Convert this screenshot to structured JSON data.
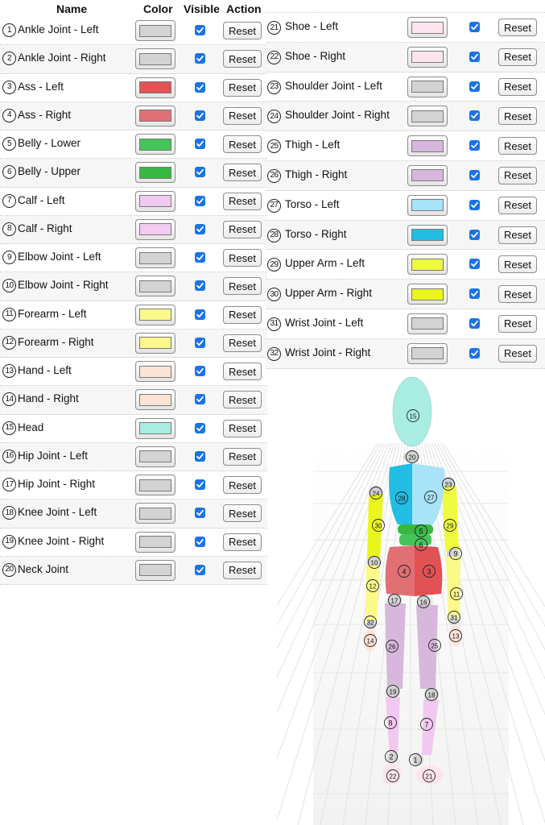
{
  "table": {
    "headers": {
      "name": "Name",
      "color": "Color",
      "visible": "Visible",
      "action": "Action"
    },
    "parts": [
      {
        "num": "1",
        "name": "Ankle Joint - Left",
        "color": "#d3d3d3",
        "visible": true,
        "action": "Reset"
      },
      {
        "num": "2",
        "name": "Ankle Joint - Right",
        "color": "#d3d3d3",
        "visible": true,
        "action": "Reset"
      },
      {
        "num": "3",
        "name": "Ass - Left",
        "color": "#e15255",
        "visible": true,
        "action": "Reset"
      },
      {
        "num": "4",
        "name": "Ass - Right",
        "color": "#e07074",
        "visible": true,
        "action": "Reset"
      },
      {
        "num": "5",
        "name": "Belly - Lower",
        "color": "#45c45a",
        "visible": true,
        "action": "Reset"
      },
      {
        "num": "6",
        "name": "Belly - Upper",
        "color": "#38b743",
        "visible": true,
        "action": "Reset"
      },
      {
        "num": "7",
        "name": "Calf - Left",
        "color": "#f1c8f0",
        "visible": true,
        "action": "Reset"
      },
      {
        "num": "8",
        "name": "Calf - Right",
        "color": "#f3caf0",
        "visible": true,
        "action": "Reset"
      },
      {
        "num": "9",
        "name": "Elbow Joint - Left",
        "color": "#d3d3d3",
        "visible": true,
        "action": "Reset"
      },
      {
        "num": "10",
        "name": "Elbow Joint - Right",
        "color": "#d3d3d3",
        "visible": true,
        "action": "Reset"
      },
      {
        "num": "11",
        "name": "Forearm - Left",
        "color": "#fbf98a",
        "visible": true,
        "action": "Reset"
      },
      {
        "num": "12",
        "name": "Forearm - Right",
        "color": "#fbf78a",
        "visible": true,
        "action": "Reset"
      },
      {
        "num": "13",
        "name": "Hand - Left",
        "color": "#fde3d6",
        "visible": true,
        "action": "Reset"
      },
      {
        "num": "14",
        "name": "Hand - Right",
        "color": "#fde3d3",
        "visible": true,
        "action": "Reset"
      },
      {
        "num": "15",
        "name": "Head",
        "color": "#a9ece1",
        "visible": true,
        "action": "Reset"
      },
      {
        "num": "16",
        "name": "Hip Joint - Left",
        "color": "#d3d3d3",
        "visible": true,
        "action": "Reset"
      },
      {
        "num": "17",
        "name": "Hip Joint - Right",
        "color": "#d3d3d3",
        "visible": true,
        "action": "Reset"
      },
      {
        "num": "18",
        "name": "Knee Joint - Left",
        "color": "#d3d3d3",
        "visible": true,
        "action": "Reset"
      },
      {
        "num": "19",
        "name": "Knee Joint - Right",
        "color": "#d3d3d3",
        "visible": true,
        "action": "Reset"
      },
      {
        "num": "20",
        "name": "Neck Joint",
        "color": "#d3d3d3",
        "visible": true,
        "action": "Reset"
      },
      {
        "num": "21",
        "name": "Shoe - Left",
        "color": "#fde4ee",
        "visible": true,
        "action": "Reset"
      },
      {
        "num": "22",
        "name": "Shoe - Right",
        "color": "#fde4ee",
        "visible": true,
        "action": "Reset"
      },
      {
        "num": "23",
        "name": "Shoulder Joint - Left",
        "color": "#d3d3d3",
        "visible": true,
        "action": "Reset"
      },
      {
        "num": "24",
        "name": "Shoulder Joint - Right",
        "color": "#d3d3d3",
        "visible": true,
        "action": "Reset"
      },
      {
        "num": "25",
        "name": "Thigh - Left",
        "color": "#d7b7dc",
        "visible": true,
        "action": "Reset"
      },
      {
        "num": "26",
        "name": "Thigh - Right",
        "color": "#d7b7dc",
        "visible": true,
        "action": "Reset"
      },
      {
        "num": "27",
        "name": "Torso - Left",
        "color": "#a8e3f8",
        "visible": true,
        "action": "Reset"
      },
      {
        "num": "28",
        "name": "Torso - Right",
        "color": "#22bde3",
        "visible": true,
        "action": "Reset"
      },
      {
        "num": "29",
        "name": "Upper Arm - Left",
        "color": "#eefb3e",
        "visible": true,
        "action": "Reset"
      },
      {
        "num": "30",
        "name": "Upper Arm - Right",
        "color": "#eaf51d",
        "visible": true,
        "action": "Reset"
      },
      {
        "num": "31",
        "name": "Wrist Joint - Left",
        "color": "#d3d3d3",
        "visible": true,
        "action": "Reset"
      },
      {
        "num": "32",
        "name": "Wrist Joint - Right",
        "color": "#d3d3d3",
        "visible": true,
        "action": "Reset"
      }
    ]
  },
  "viewer": {
    "figure_colors": {
      "head": "#a9ece1",
      "torso_left": "#a8e3f8",
      "torso_right": "#22bde3",
      "belly_upper": "#38b743",
      "belly_lower": "#45c45a",
      "ass_left": "#e15255",
      "ass_right": "#e07074",
      "upper_arm_left": "#eefb3e",
      "upper_arm_right": "#eaf51d",
      "forearm": "#fbf98a",
      "hand": "#fde3d6",
      "thigh": "#d7b7dc",
      "calf": "#f1c8f0",
      "shoe": "#fde4ee",
      "joint": "#d3d3d3"
    },
    "markers": [
      "1",
      "2",
      "3",
      "4",
      "5",
      "6",
      "7",
      "8",
      "9",
      "10",
      "11",
      "12",
      "13",
      "14",
      "15",
      "16",
      "17",
      "18",
      "19",
      "20",
      "21",
      "22",
      "23",
      "24",
      "25",
      "26",
      "27",
      "28",
      "29",
      "30",
      "31",
      "32"
    ]
  }
}
